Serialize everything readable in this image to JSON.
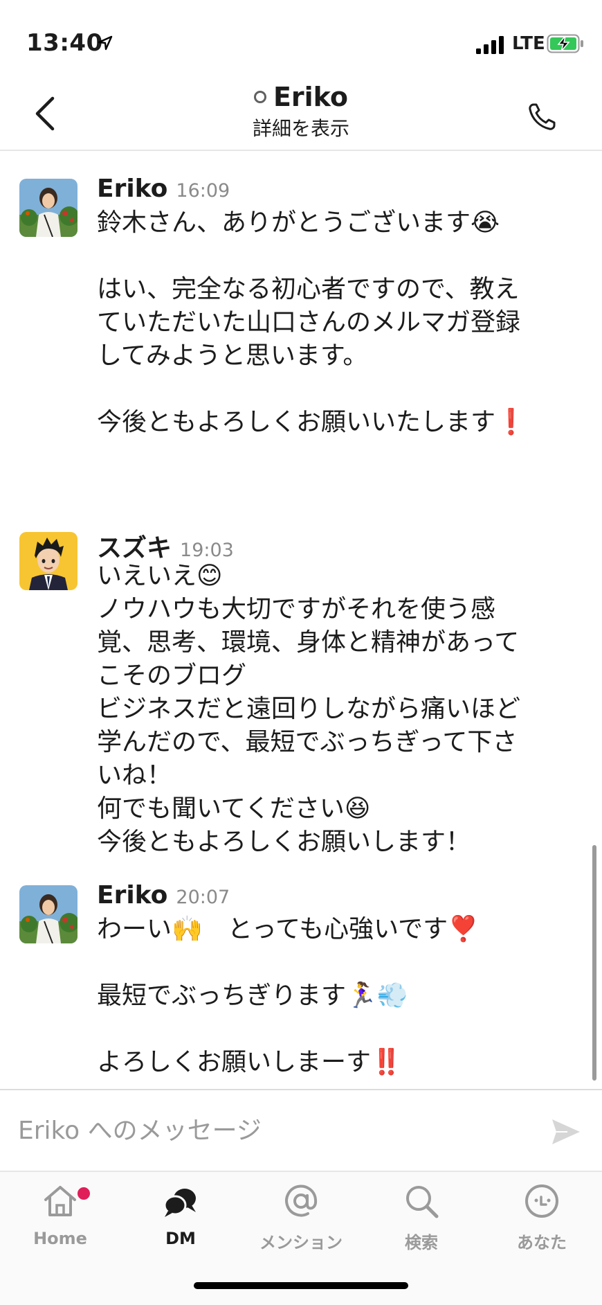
{
  "status_bar": {
    "time": "13:40",
    "network": "LTE"
  },
  "header": {
    "title": "Eriko",
    "subtitle": "詳細を表示"
  },
  "messages": [
    {
      "sender": "Eriko",
      "time": "16:09",
      "avatar": "photo",
      "lines": [
        "鈴木さん、ありがとうございます😭",
        "",
        "はい、完全なる初心者ですので、教え",
        "ていただいた山口さんのメルマガ登録",
        "してみようと思います。",
        "",
        "今後ともよろしくお願いいたします❗"
      ]
    },
    {
      "sender": "スズキ",
      "time": "19:03",
      "avatar": "illustration",
      "lines": [
        "いえいえ😊",
        "ノウハウも大切ですがそれを使う感",
        "覚、思考、環境、身体と精神があって",
        "こそのブログ",
        "ビジネスだと遠回りしながら痛いほど",
        "学んだので、最短でぶっちぎって下さ",
        "いね！",
        "何でも聞いてください😆",
        "今後ともよろしくお願いします！"
      ]
    },
    {
      "sender": "Eriko",
      "time": "20:07",
      "avatar": "photo",
      "lines": [
        "わーい🙌　とっても心強いです❣️",
        "",
        "最短でぶっちぎります🏃‍♀️💨",
        "",
        "よろしくお願いしまーす‼️"
      ]
    }
  ],
  "composer": {
    "placeholder": "Eriko へのメッセージ"
  },
  "tabs": [
    {
      "label": "Home",
      "icon": "home-icon",
      "active": false,
      "badge": true
    },
    {
      "label": "DM",
      "icon": "dm-icon",
      "active": true,
      "badge": false
    },
    {
      "label": "メンション",
      "icon": "mention-icon",
      "active": false,
      "badge": false
    },
    {
      "label": "検索",
      "icon": "search-icon",
      "active": false,
      "badge": false
    },
    {
      "label": "あなた",
      "icon": "you-icon",
      "active": false,
      "badge": false
    }
  ],
  "colors": {
    "badge": "#e01e5a",
    "timestamp": "#8a8a8a",
    "inactive_tab": "#9a9a9a"
  }
}
